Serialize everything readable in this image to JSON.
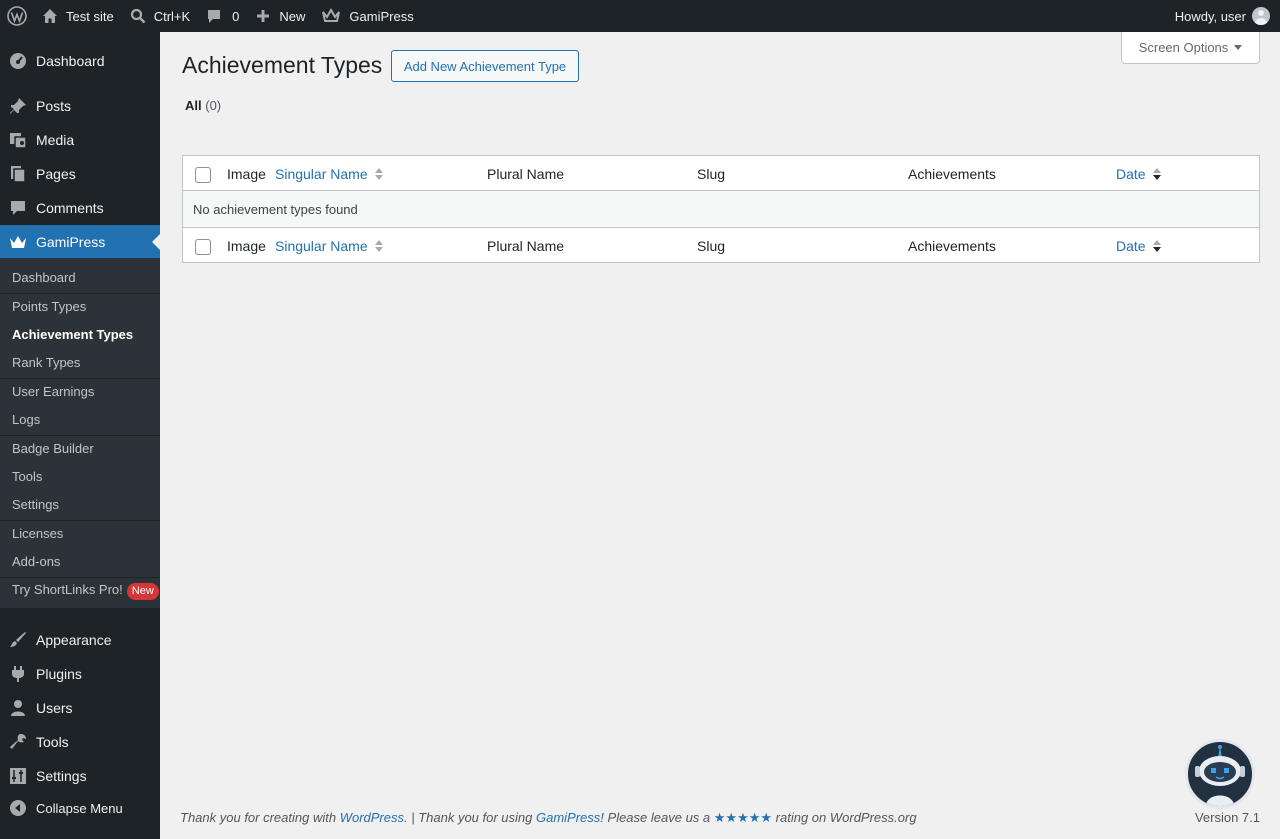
{
  "adminbar": {
    "site_name": "Test site",
    "search_shortcut": "Ctrl+K",
    "comments_count": "0",
    "new_label": "New",
    "plugin_label": "GamiPress",
    "greeting": "Howdy, user"
  },
  "sidebar": {
    "items": [
      {
        "label": "Dashboard",
        "icon": "dashboard-icon"
      },
      {
        "label": "Posts",
        "icon": "pin-icon"
      },
      {
        "label": "Media",
        "icon": "media-icon"
      },
      {
        "label": "Pages",
        "icon": "pages-icon"
      },
      {
        "label": "Comments",
        "icon": "comment-icon"
      },
      {
        "label": "GamiPress",
        "icon": "crown-icon"
      },
      {
        "label": "Appearance",
        "icon": "brush-icon"
      },
      {
        "label": "Plugins",
        "icon": "plug-icon"
      },
      {
        "label": "Users",
        "icon": "user-icon"
      },
      {
        "label": "Tools",
        "icon": "wrench-icon"
      },
      {
        "label": "Settings",
        "icon": "sliders-icon"
      },
      {
        "label": "Collapse Menu",
        "icon": "collapse-icon"
      }
    ],
    "submenu": [
      "Dashboard",
      "Points Types",
      "Achievement Types",
      "Rank Types",
      "User Earnings",
      "Logs",
      "Badge Builder",
      "Tools",
      "Settings",
      "Licenses",
      "Add-ons",
      "Try ShortLinks Pro!"
    ],
    "new_badge": "New"
  },
  "main": {
    "screen_options": "Screen Options",
    "title": "Achievement Types",
    "add_new": "Add New Achievement Type",
    "filter_all": "All",
    "filter_count": "(0)",
    "columns": {
      "image": "Image",
      "singular": "Singular Name",
      "plural": "Plural Name",
      "slug": "Slug",
      "achievements": "Achievements",
      "date": "Date"
    },
    "empty_message": "No achievement types found"
  },
  "footer": {
    "text1": "Thank you for creating with ",
    "wordpress_link": "WordPress",
    "text2": ". | Thank you for using ",
    "gamipress_link": "GamiPress",
    "text3": "! Please leave us a ",
    "stars": "★★★★★",
    "text4": " rating on WordPress.org",
    "version": "Version 7.1"
  },
  "colors": {
    "adminbar_bg": "#1d2327",
    "current_menu": "#2271b1",
    "link": "#2271b1",
    "badge_red": "#d63638"
  }
}
